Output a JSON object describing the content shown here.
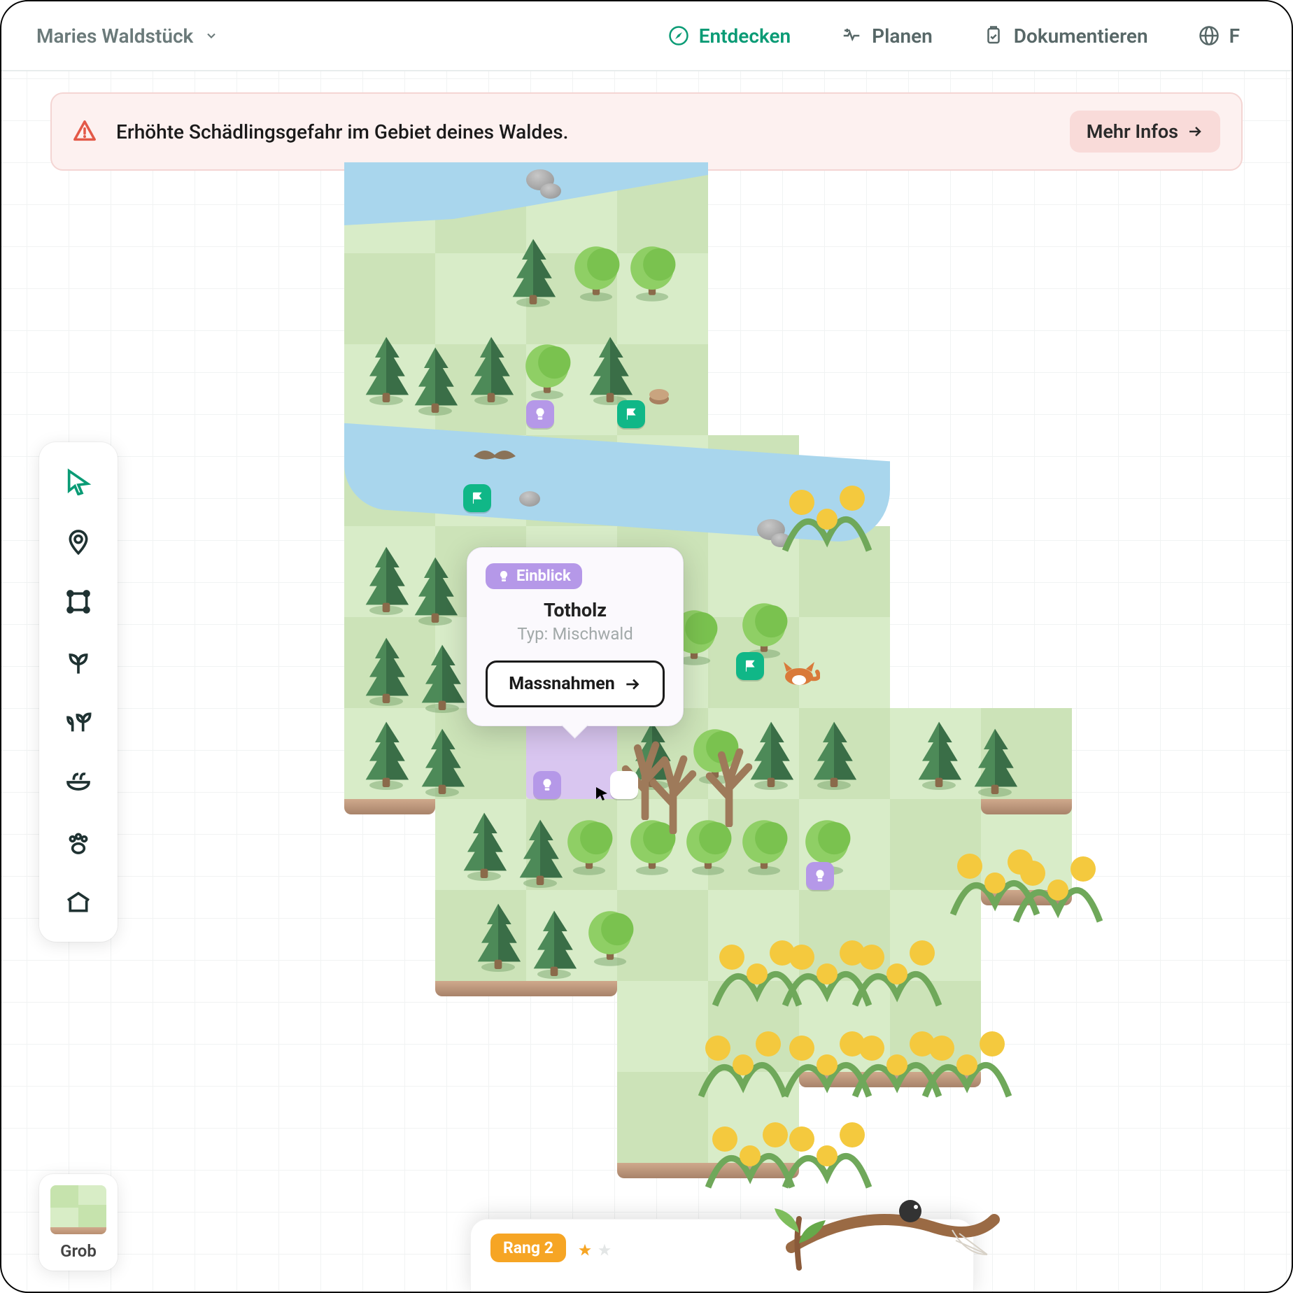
{
  "header": {
    "forest_name": "Maries Waldstück",
    "nav": {
      "entdecken": "Entdecken",
      "planen": "Planen",
      "dokumentieren": "Dokumentieren",
      "partial": "F"
    }
  },
  "alert": {
    "message": "Erhöhte Schädlingsgefahr im Gebiet deines Waldes.",
    "more_label": "Mehr Infos"
  },
  "toolbar": {
    "tools": [
      "cursor",
      "pin",
      "area",
      "sprout",
      "plants",
      "nuts",
      "animals",
      "shelter"
    ]
  },
  "popup": {
    "badge": "Einblick",
    "title": "Totholz",
    "subtitle": "Typ: Mischwald",
    "action": "Massnahmen"
  },
  "zoom": {
    "label": "Grob"
  },
  "rank": {
    "label": "Rang 2",
    "filled_stars": 1,
    "empty_stars": 1
  },
  "colors": {
    "accent": "#0a9b75",
    "alert_bg": "#fdf1f0",
    "purple": "#b598e8",
    "orange": "#f6a524",
    "water": "#a9d6ed",
    "grass_light": "#d8ecc8",
    "grass_dark": "#cce3b8"
  }
}
